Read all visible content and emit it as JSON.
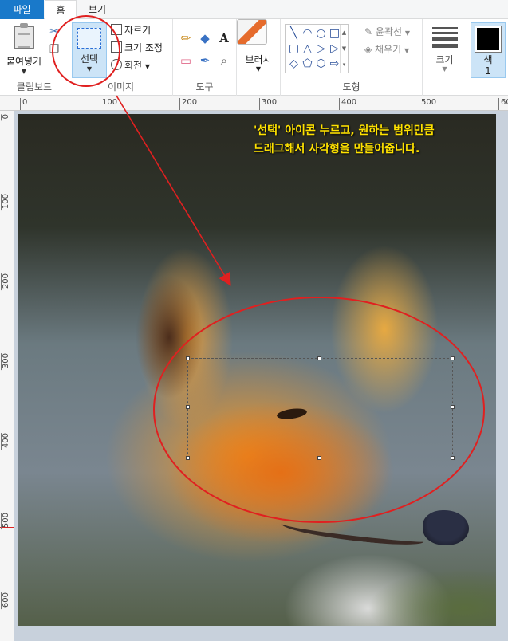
{
  "tabs": {
    "file": "파일",
    "home": "홈",
    "view": "보기"
  },
  "clipboard": {
    "paste_label": "붙여넣기",
    "group_label": "클립보드",
    "cut_icon": "scissors-icon",
    "copy_icon": "copy-icon"
  },
  "image": {
    "select_label": "선택",
    "crop_label": "자르기",
    "resize_label": "크기 조정",
    "rotate_label": "회전",
    "group_label": "이미지"
  },
  "tools": {
    "group_label": "도구",
    "pencil": "✏",
    "fill": "◆",
    "text": "A",
    "eraser": "▭",
    "picker": "✒",
    "magnifier": "⌕"
  },
  "brush": {
    "label": "브러시"
  },
  "shapes": {
    "group_label": "도형",
    "items": [
      "╲",
      "◠",
      "○",
      "□",
      "▢",
      "△",
      "▷",
      "▷",
      "◇",
      "⬠",
      "⬡",
      "⇨"
    ],
    "outline_label": "윤곽선",
    "fill_label": "채우기"
  },
  "size": {
    "label": "크기"
  },
  "color": {
    "label": "색",
    "number": "1",
    "current": "#000000"
  },
  "ruler": {
    "h_ticks": [
      "0",
      "100",
      "200",
      "300",
      "400",
      "500",
      "60"
    ],
    "v_ticks": [
      "0",
      "100",
      "200",
      "300",
      "400",
      "500",
      "600"
    ]
  },
  "annotation": {
    "line1": "'선택' 아이콘 누르고, 원하는 범위만큼",
    "line2": "드래그해서 사각형을 만들어줍니다."
  },
  "colors": {
    "accent": "#1979ca",
    "annotation_red": "#e02020",
    "annotation_text": "#ffe200"
  }
}
